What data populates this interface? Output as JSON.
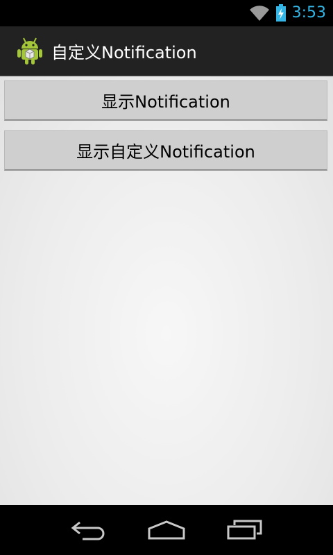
{
  "status_bar": {
    "time": "3:53",
    "icons": [
      "wifi-icon",
      "battery-charging-icon"
    ],
    "accent_color": "#33b5e5"
  },
  "action_bar": {
    "app_icon": "android-robot-icon",
    "title": "自定义Notification"
  },
  "main": {
    "buttons": [
      {
        "label": "显示Notification"
      },
      {
        "label": "显示自定义Notification"
      }
    ]
  },
  "nav_bar": {
    "icons": [
      "back-icon",
      "home-icon",
      "recent-apps-icon"
    ]
  }
}
